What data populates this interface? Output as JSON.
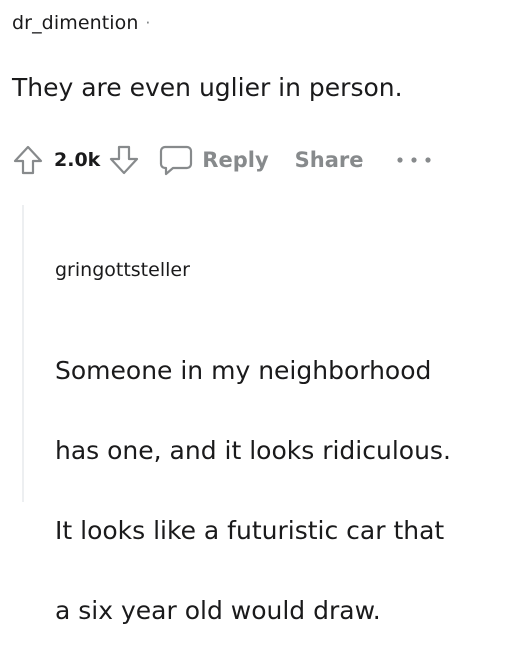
{
  "parent_comment": {
    "username": "dr_dimention",
    "separator": "·",
    "body": "They are even uglier in person.",
    "score": "2.0k",
    "reply_label": "Reply",
    "share_label": "Share",
    "more_icon": "ellipsis-icon"
  },
  "child_comment": {
    "username": "gringottsteller",
    "body_lines": [
      "Someone in my neighborhood",
      "has one, and it looks ridiculous.",
      "It looks like a futuristic car that",
      "a six year old would draw."
    ]
  },
  "colors": {
    "text": "#1a1a1b",
    "muted": "#878a8c",
    "thread_line": "#edeff1"
  }
}
